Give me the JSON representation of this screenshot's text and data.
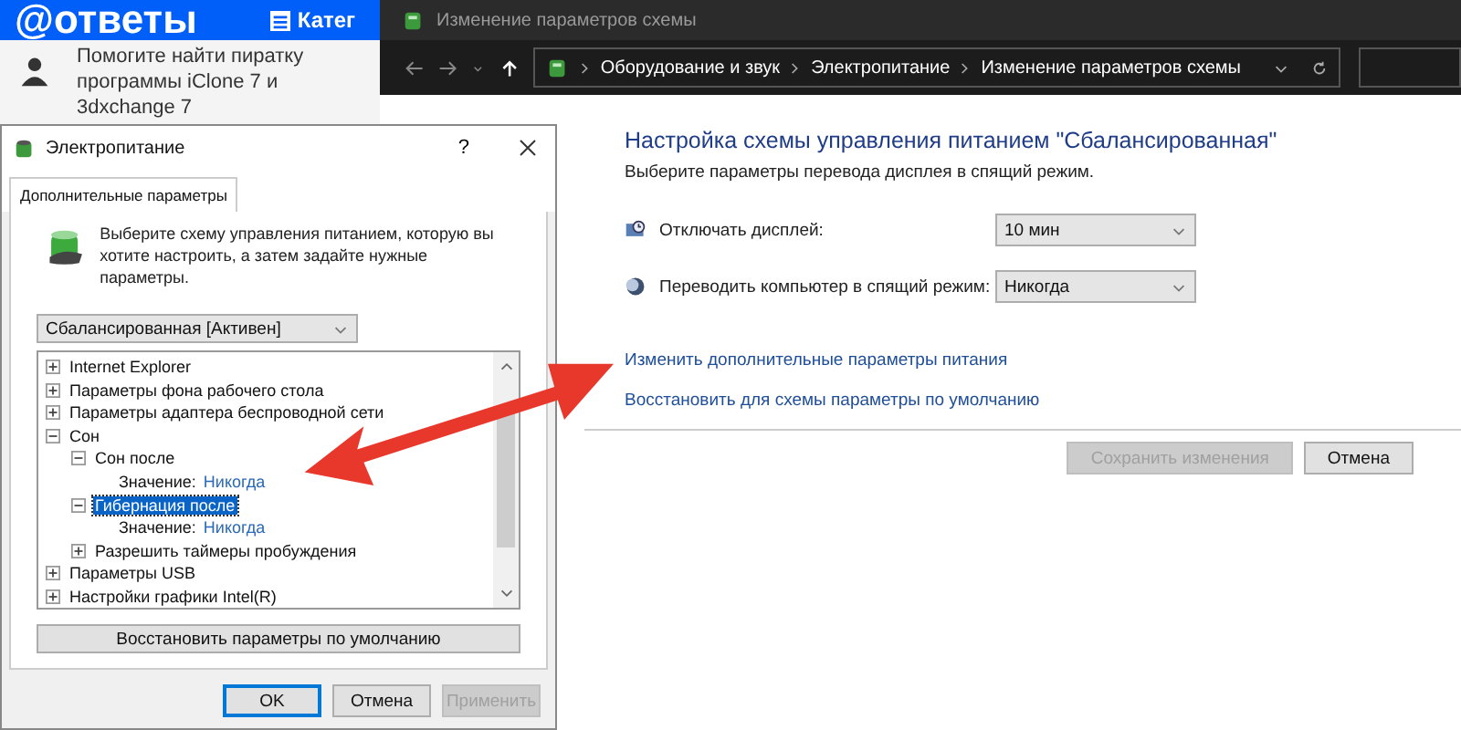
{
  "web_page": {
    "logo": "@ответы",
    "nav_item": "Катег",
    "question": "Помогите найти пиратку программы iClone 7 и 3dxchange 7"
  },
  "explorer": {
    "title": "Изменение параметров схемы",
    "breadcrumbs": [
      "Оборудование и звук",
      "Электропитание",
      "Изменение параметров схемы"
    ],
    "heading": "Настройка схемы управления питанием \"Сбалансированная\"",
    "subheading": "Выберите параметры перевода дисплея в спящий режим.",
    "settings": [
      {
        "kind": "display",
        "label": "Отключать дисплей:",
        "value": "10 мин"
      },
      {
        "kind": "sleep",
        "label": "Переводить компьютер в спящий режим:",
        "value": "Никогда"
      }
    ],
    "links": [
      "Изменить дополнительные параметры питания",
      "Восстановить для схемы параметры по умолчанию"
    ],
    "buttons": [
      {
        "label": "Сохранить изменения",
        "disabled": true
      },
      {
        "label": "Отмена",
        "disabled": false
      }
    ]
  },
  "dialog": {
    "title": "Электропитание",
    "help": "?",
    "tab": {
      "label": "Дополнительные параметры",
      "selected": true
    },
    "intro": "Выберите схему управления питанием, которую вы хотите настроить, а затем задайте нужные параметры.",
    "plan": "Сбалансированная [Активен]",
    "tree": [
      {
        "kind": "node",
        "label": "Internet Explorer",
        "expanded": false,
        "selected": false
      },
      {
        "kind": "node",
        "label": "Параметры фона рабочего стола",
        "expanded": false,
        "selected": false
      },
      {
        "kind": "node",
        "label": "Параметры адаптера беспроводной сети",
        "expanded": false,
        "selected": false
      },
      {
        "kind": "node",
        "label": "Сон",
        "expanded": true,
        "selected": false,
        "children": [
          {
            "kind": "node",
            "label": "Сон после",
            "expanded": true,
            "selected": false,
            "children": [
              {
                "kind": "value",
                "label": "Значение:",
                "value": "Никогда"
              }
            ]
          },
          {
            "kind": "node",
            "label": "Гибернация после",
            "expanded": true,
            "selected": true,
            "children": [
              {
                "kind": "value",
                "label": "Значение:",
                "value": "Никогда"
              }
            ]
          },
          {
            "kind": "node",
            "label": "Разрешить таймеры пробуждения",
            "expanded": false,
            "selected": false
          }
        ]
      },
      {
        "kind": "node",
        "label": "Параметры USB",
        "expanded": false,
        "selected": false
      },
      {
        "kind": "node",
        "label": "Настройки графики Intel(R)",
        "expanded": false,
        "selected": false
      }
    ],
    "restore_button": "Восстановить параметры по умолчанию",
    "buttons": [
      {
        "label": "OK",
        "disabled": false,
        "default": true
      },
      {
        "label": "Отмена",
        "disabled": false,
        "default": false
      },
      {
        "label": "Применить",
        "disabled": true,
        "default": false
      }
    ]
  }
}
